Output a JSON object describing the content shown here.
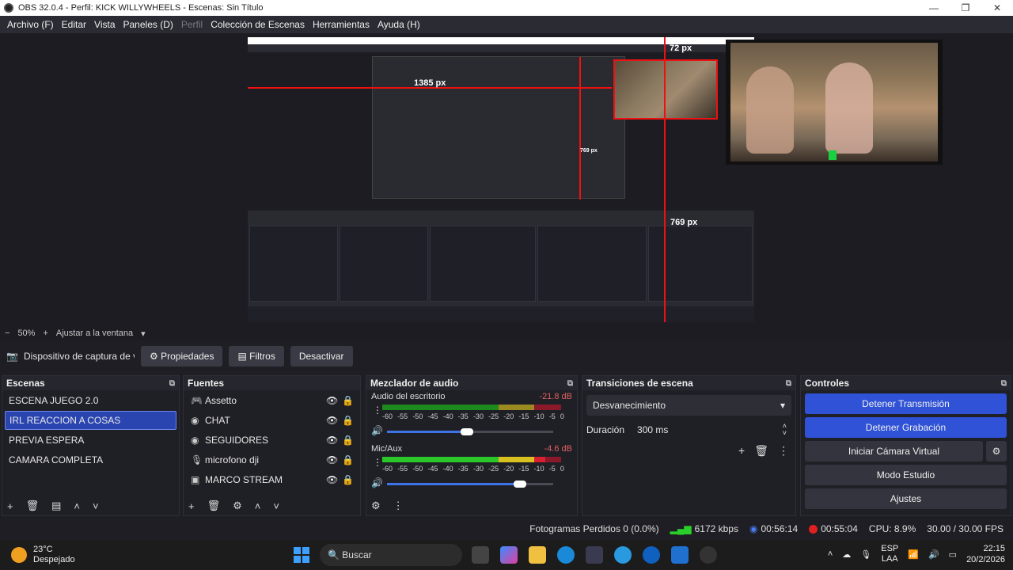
{
  "window": {
    "title": "OBS 32.0.4 - Perfil: KICK WILLYWHEELS - Escenas: Sin Título",
    "minimize": "—",
    "maximize": "❐",
    "close": "✕"
  },
  "menu": {
    "items": [
      "Archivo (F)",
      "Editar",
      "Vista",
      "Paneles (D)",
      "Perfil",
      "Colección de Escenas",
      "Herramientas",
      "Ayuda (H)"
    ]
  },
  "preview": {
    "labels": {
      "width_label": "1385 px",
      "top_label": "72 px",
      "mid_label": "769 px",
      "bottom_label": "769 px"
    }
  },
  "zoom": {
    "minus": "−",
    "level": "50%",
    "plus": "+",
    "fit": "Ajustar a la ventana",
    "caret": "▾"
  },
  "source_toolbar": {
    "source_name": "Dispositivo de captura de v",
    "properties": "Propiedades",
    "filters": "Filtros",
    "deactivate": "Desactivar"
  },
  "scenes": {
    "title": "Escenas",
    "items": [
      "ESCENA JUEGO 2.0",
      "IRL REACCION A COSAS",
      "PREVIA ESPERA",
      "CAMARA COMPLETA"
    ],
    "selected": 1
  },
  "sources": {
    "title": "Fuentes",
    "items": [
      "Assetto",
      "CHAT",
      "SEGUIDORES",
      "microfono dji",
      "MARCO STREAM"
    ]
  },
  "mixer": {
    "title": "Mezclador de audio",
    "channels": [
      {
        "name": "Audio del escritorio",
        "db": "-21.8 dB",
        "volume": 0.48
      },
      {
        "name": "Mic/Aux",
        "db": "-4.6 dB",
        "volume": 0.8
      }
    ],
    "scale": [
      "-60",
      "-55",
      "-50",
      "-45",
      "-40",
      "-35",
      "-30",
      "-25",
      "-20",
      "-15",
      "-10",
      "-5",
      "0"
    ]
  },
  "transitions": {
    "title": "Transiciones de escena",
    "selected": "Desvanecimiento",
    "duration_label": "Duración",
    "duration_value": "300 ms"
  },
  "controls": {
    "title": "Controles",
    "stop_stream": "Detener Transmisión",
    "stop_recording": "Detener Grabación",
    "virtual_cam": "Iniciar Cámara Virtual",
    "studio_mode": "Modo Estudio",
    "settings": "Ajustes"
  },
  "status": {
    "dropped": "Fotogramas Perdidos 0 (0.0%)",
    "bitrate": "6172 kbps",
    "stream_time": "00:56:14",
    "rec_time": "00:55:04",
    "cpu": "CPU: 8.9%",
    "fps": "30.00 / 30.00 FPS"
  },
  "taskbar": {
    "temp": "23°C",
    "weather": "Despejado",
    "search": "Buscar",
    "lang_top": "ESP",
    "lang_bottom": "LAA",
    "time": "22:15",
    "date": "20/2/2026"
  },
  "colors": {
    "accent": "#2f52d6",
    "selected": "#2a45b0",
    "guide": "#ee1111"
  }
}
